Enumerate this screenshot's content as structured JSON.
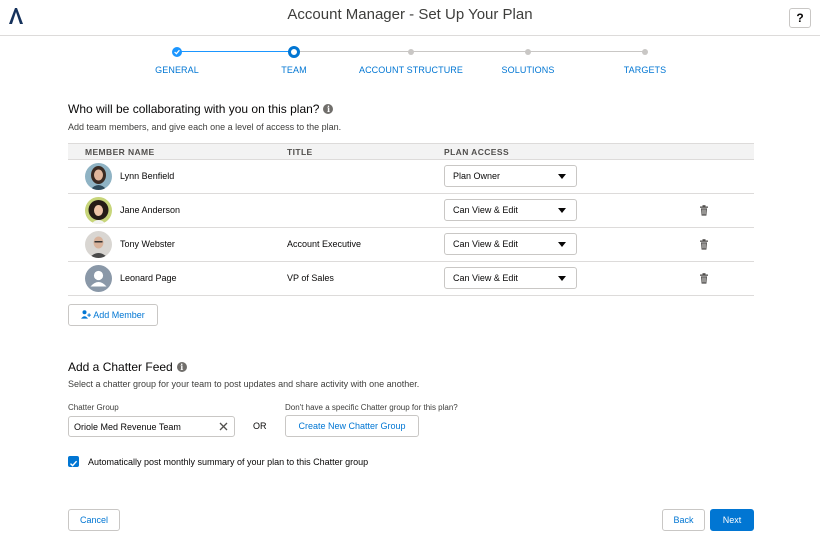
{
  "header": {
    "title": "Account Manager - Set Up Your Plan",
    "help_label": "?"
  },
  "steps": [
    {
      "label": "GENERAL",
      "state": "done"
    },
    {
      "label": "TEAM",
      "state": "active"
    },
    {
      "label": "ACCOUNT STRUCTURE",
      "state": "future"
    },
    {
      "label": "SOLUTIONS",
      "state": "future"
    },
    {
      "label": "TARGETS",
      "state": "future"
    }
  ],
  "team": {
    "title": "Who will be collaborating with you on this plan?",
    "subtitle": "Add team members, and give each one a level of access to the plan.",
    "columns": {
      "name": "MEMBER NAME",
      "title": "TITLE",
      "access": "PLAN ACCESS"
    },
    "members": [
      {
        "name": "Lynn Benfield",
        "title": "",
        "access": "Plan Owner",
        "removable": false
      },
      {
        "name": "Jane Anderson",
        "title": "",
        "access": "Can View & Edit",
        "removable": true
      },
      {
        "name": "Tony Webster",
        "title": "Account Executive",
        "access": "Can View & Edit",
        "removable": true
      },
      {
        "name": "Leonard Page",
        "title": "VP of Sales",
        "access": "Can View & Edit",
        "removable": true
      }
    ],
    "add_member_label": "Add Member"
  },
  "chatter": {
    "title": "Add a Chatter Feed",
    "subtitle": "Select a chatter group for your team to post updates and share activity with one another.",
    "group_label": "Chatter Group",
    "group_value": "Oriole Med Revenue Team",
    "or_label": "OR",
    "no_group_label": "Don't have a specific Chatter group for this plan?",
    "create_label": "Create New Chatter Group",
    "checkbox_label": "Automatically post monthly summary of your plan to this Chatter group",
    "checkbox_checked": true
  },
  "footer": {
    "cancel_label": "Cancel",
    "back_label": "Back",
    "next_label": "Next"
  },
  "colors": {
    "brand": "#0176d3",
    "progress": "#1b96ff",
    "border": "#c9c7c5"
  }
}
